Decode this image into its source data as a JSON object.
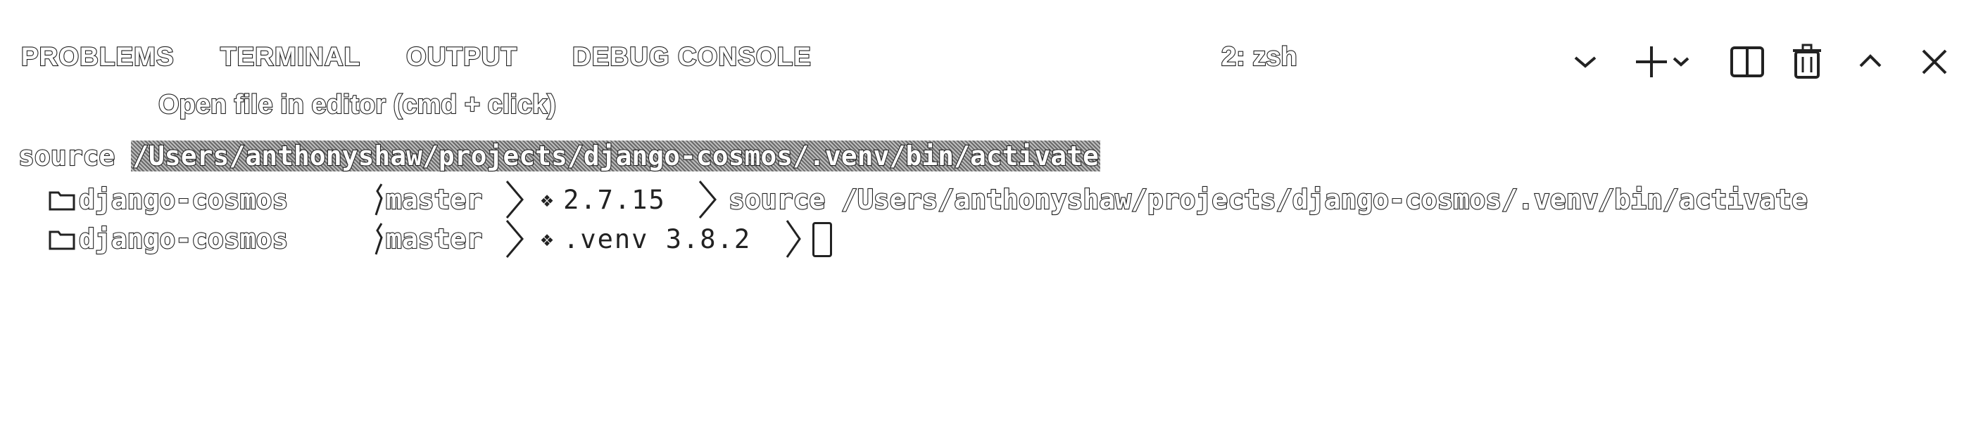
{
  "panel": {
    "tabs": [
      {
        "label": "PROBLEMS"
      },
      {
        "label": "TERMINAL",
        "active": true
      },
      {
        "label": "OUTPUT"
      },
      {
        "label": "DEBUG CONSOLE"
      }
    ],
    "terminal_select": "2: zsh",
    "actions": [
      "chevron-down-icon",
      "plus-icon",
      "split-icon",
      "trash-icon",
      "chevron-up-icon",
      "close-icon"
    ]
  },
  "tooltip": "Open file in editor (cmd + click)",
  "terminal": {
    "line1": {
      "command": "source",
      "path": "/Users/anthonyshaw/projects/django-cosmos/.venv/bin/activate"
    },
    "line2": {
      "folder": "django-cosmos",
      "branch": "master",
      "python": "2.7.15",
      "command": "source",
      "path": "/Users/anthonyshaw/projects/django-cosmos/.venv/bin/activate"
    },
    "line3": {
      "folder": "django-cosmos",
      "branch": "master",
      "python": ".venv 3.8.2"
    }
  },
  "colors": {
    "background": "#ffffff",
    "foreground": "#222222",
    "link_highlight": "#8a8a8a"
  }
}
